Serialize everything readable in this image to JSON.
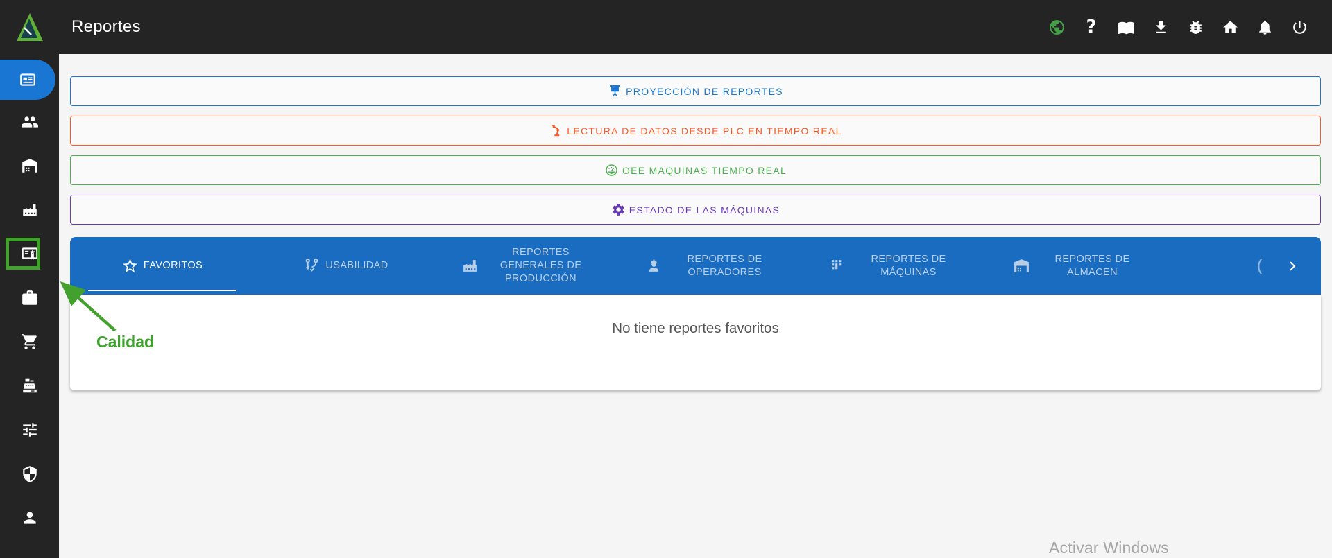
{
  "colors": {
    "topbar_dark": "#242424",
    "sidebar_active_blue": "#1976d2",
    "tabbar_blue": "#1a6cc1",
    "banner_blue": "#1976d2",
    "banner_orange": "#ff5722",
    "banner_green": "#4caf50",
    "banner_purple": "#673ab7",
    "annotation_green": "#42a02c",
    "globe_green": "#43a047"
  },
  "header": {
    "title": "Reportes",
    "help_glyph": "?",
    "icons": [
      "globe",
      "help",
      "book",
      "download",
      "bug",
      "home",
      "notifications",
      "power"
    ]
  },
  "sidebar": {
    "items": [
      "reports (active)",
      "users",
      "warehouse",
      "production",
      "quality (highlighted)",
      "tools",
      "shopping-cart",
      "cash-register",
      "tune",
      "security",
      "profile"
    ]
  },
  "banners": [
    {
      "label": "PROYECCIÓN DE REPORTES",
      "color": "#1976d2",
      "icon": "projector-screen"
    },
    {
      "label": "LECTURA DE DATOS DESDE PLC EN TIEMPO REAL",
      "color": "#ff5722",
      "icon": "robot-arm"
    },
    {
      "label": "OEE MAQUINAS TIEMPO REAL",
      "color": "#4caf50",
      "icon": "gauge"
    },
    {
      "label": "ESTADO DE LAS MÁQUINAS",
      "color": "#673ab7",
      "icon": "gear"
    }
  ],
  "tabs": {
    "scroll_left_glyph": "(",
    "items": [
      {
        "label": "FAVORITOS",
        "icon": "star",
        "active": true
      },
      {
        "label": "USABILIDAD",
        "icon": "usability-flow",
        "active": false
      },
      {
        "label": "REPORTES GENERALES DE PRODUCCIÓN",
        "icon": "factory",
        "active": false
      },
      {
        "label": "REPORTES DE OPERADORES",
        "icon": "operator",
        "active": false
      },
      {
        "label": "REPORTES DE MÁQUINAS",
        "icon": "machines-grid",
        "active": false
      },
      {
        "label": "REPORTES DE ALMACEN",
        "icon": "warehouse",
        "active": false
      }
    ]
  },
  "favorites": {
    "empty_message": "No tiene reportes favoritos"
  },
  "annotation": {
    "label": "Calidad"
  },
  "watermark": {
    "text": "Activar Windows"
  }
}
